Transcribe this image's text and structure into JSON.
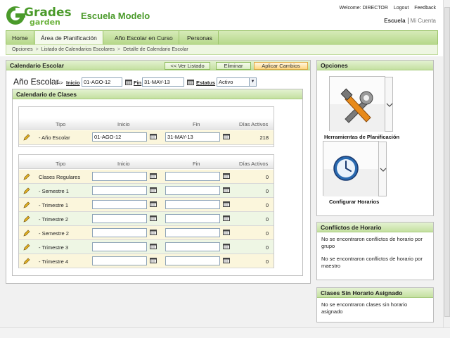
{
  "header": {
    "logo_top": "Grades",
    "logo_bottom": "garden",
    "school_name": "Escuela Modelo",
    "welcome": "Welcome: DIRECTOR",
    "logout": "Logout",
    "feedback": "Feedback",
    "lang_active": "Escuela",
    "lang_other": "Mi Cuenta"
  },
  "nav": {
    "tabs": [
      {
        "label": "Home"
      },
      {
        "label": "Área de Planificación"
      },
      {
        "label": "Año Escolar en Curso"
      },
      {
        "label": "Personas"
      }
    ]
  },
  "breadcrumb": [
    "Opciones",
    "Listado de Calendarios Escolares",
    "Detalle de Calendario Escolar"
  ],
  "calendar": {
    "title": "Calendario Escolar",
    "btn_back": "<< Ver Listado",
    "btn_delete": "Eliminar",
    "btn_apply": "Aplicar Cambios",
    "year_label": "Año Escolar",
    "arrow": "=>",
    "inicio_label": "Inicio",
    "inicio_value": "01-AGO-12",
    "fin_label": "Fin",
    "fin_value": "31-MAY-13",
    "estatus_label": "Estatus",
    "estatus_value": "Activo"
  },
  "classes": {
    "title": "Calendario de Clases",
    "headers": {
      "tipo": "Tipo",
      "inicio": "Inicio",
      "fin": "Fin",
      "dias": "Días Activos"
    },
    "year_row": {
      "tipo": "- Año Escolar",
      "inicio": "01-AGO-12",
      "fin": "31-MAY-13",
      "dias": "218"
    },
    "rows": [
      {
        "tipo": "Clases Regulares",
        "inicio": "",
        "fin": "",
        "dias": "0"
      },
      {
        "tipo": "- Semestre 1",
        "inicio": "",
        "fin": "",
        "dias": "0"
      },
      {
        "tipo": "- Trimestre 1",
        "inicio": "",
        "fin": "",
        "dias": "0"
      },
      {
        "tipo": "- Trimestre 2",
        "inicio": "",
        "fin": "",
        "dias": "0"
      },
      {
        "tipo": "- Semestre 2",
        "inicio": "",
        "fin": "",
        "dias": "0"
      },
      {
        "tipo": "- Trimestre 3",
        "inicio": "",
        "fin": "",
        "dias": "0"
      },
      {
        "tipo": "- Trimestre 4",
        "inicio": "",
        "fin": "",
        "dias": "0"
      }
    ]
  },
  "options": {
    "title": "Opciones",
    "tool1": "Herramientas de Planificación",
    "tool2": "Configurar Horarios"
  },
  "conflicts": {
    "title": "Conflictos de Horario",
    "msg_group": "No se encontraron conflictos de horario por grupo",
    "msg_teacher": "No se encontraron conflictos de horario por maestro"
  },
  "unassigned": {
    "title": "Clases Sin Horario Asignado",
    "msg": "No se encontraron clases sin horario asignado"
  },
  "colors": {
    "brand_green": "#4a9a2a",
    "header_green": "#c4e0a0",
    "apply_orange": "#ffd680",
    "row_yellow": "#fbf6dc",
    "row_green": "#eef6e4"
  },
  "icons": [
    "pencil-icon",
    "calendar-icon",
    "tools-icon",
    "clock-icon",
    "chevron-down-icon"
  ]
}
